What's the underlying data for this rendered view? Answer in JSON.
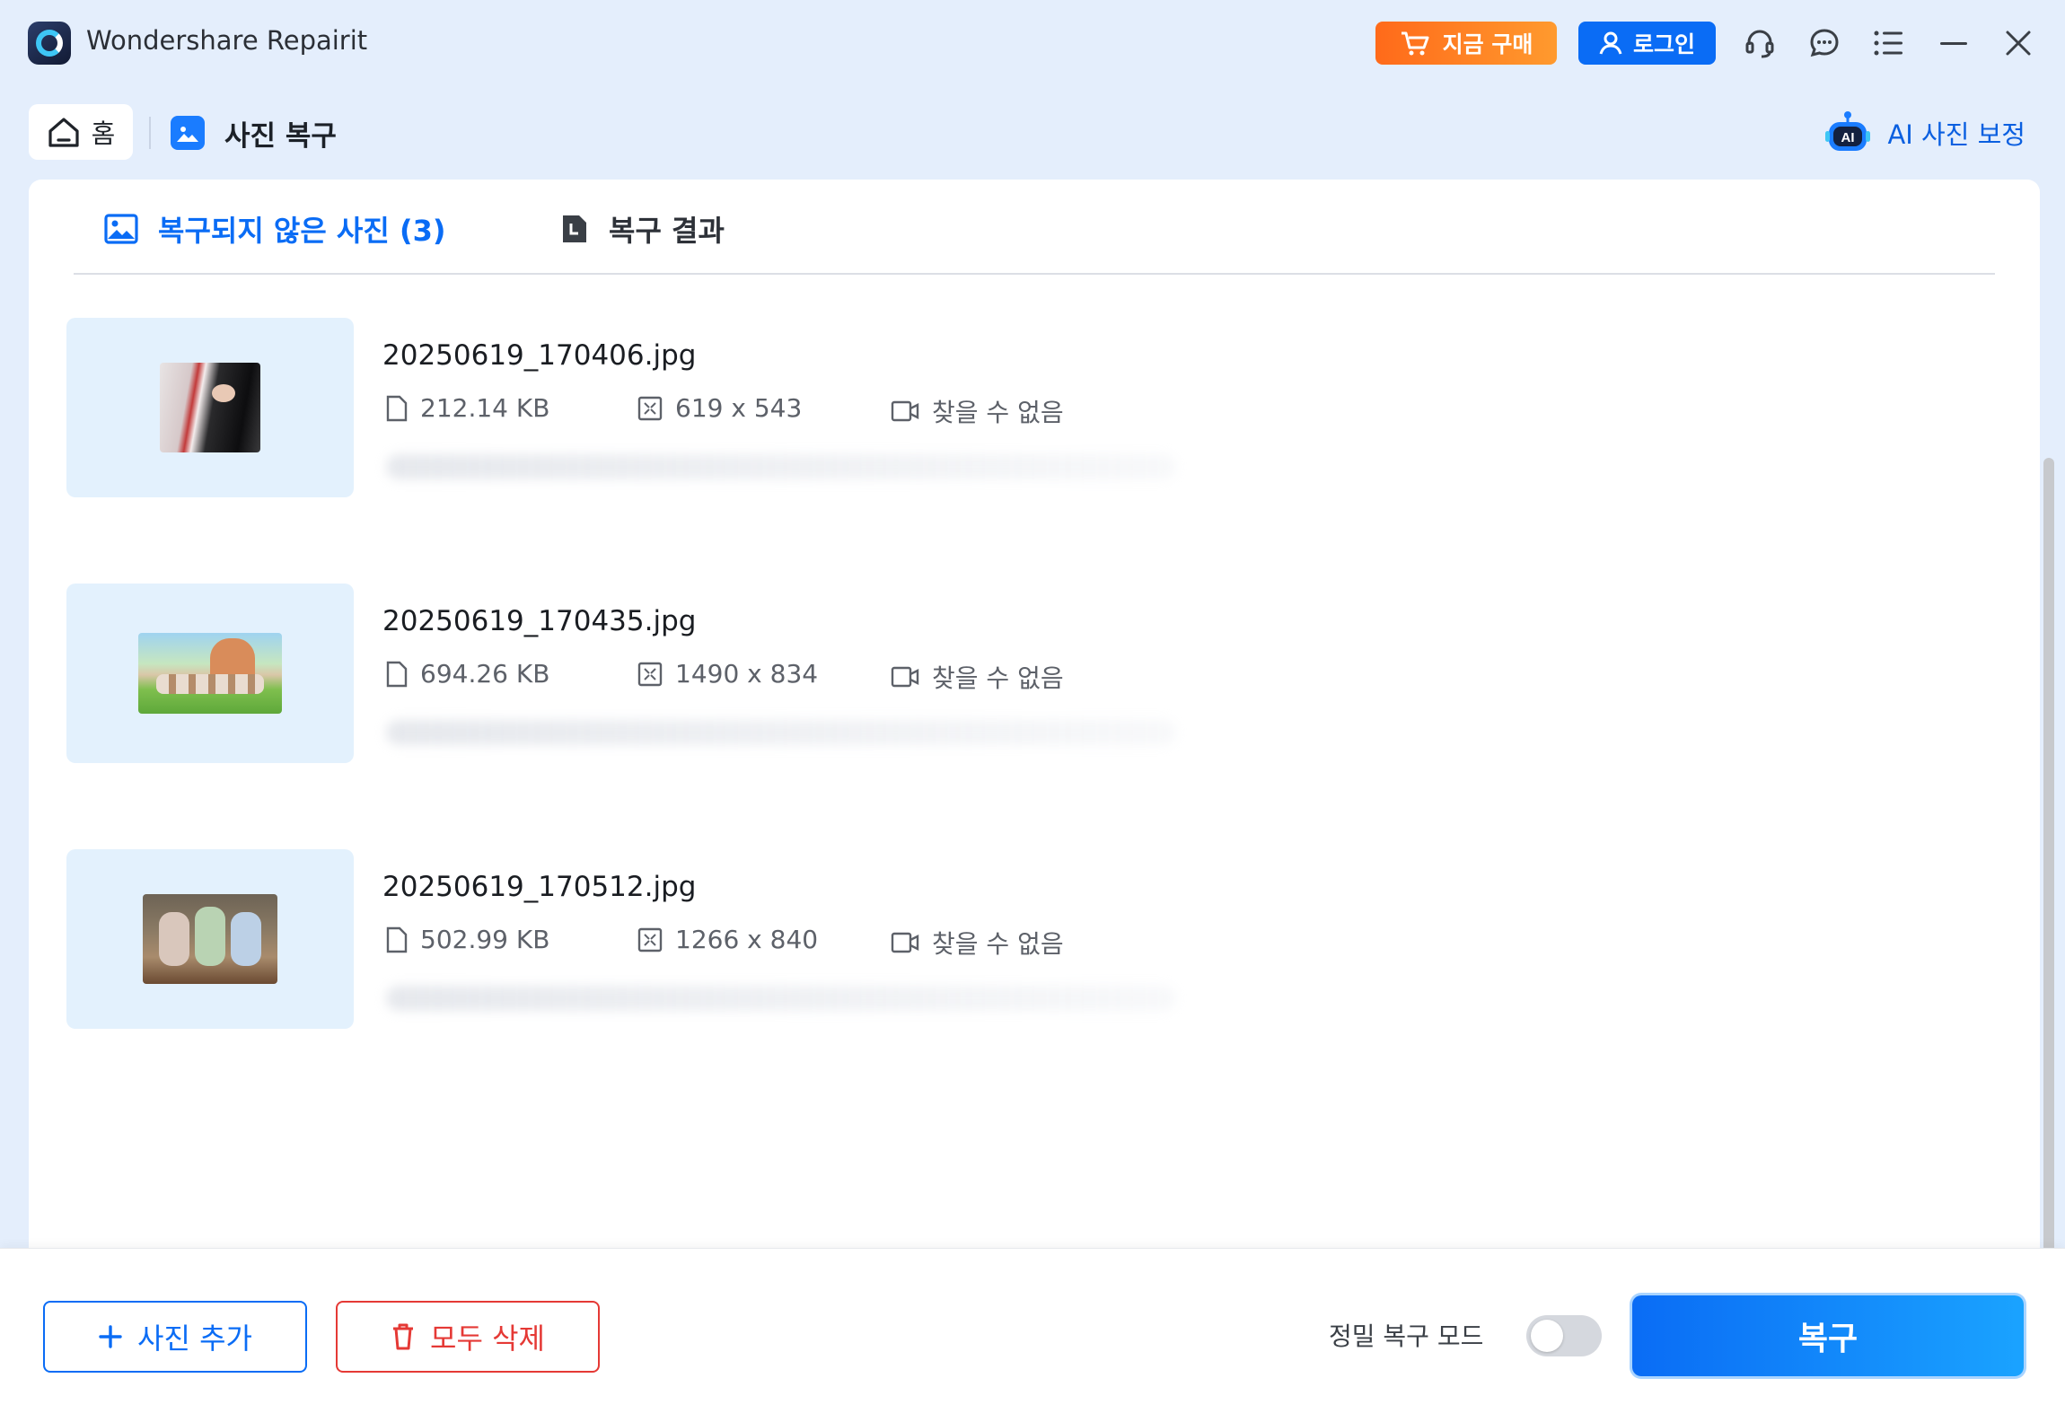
{
  "app": {
    "title": "Wondershare Repairit"
  },
  "titlebar": {
    "buy_label": "지금 구매",
    "login_label": "로그인",
    "icons": [
      "support-icon",
      "feedback-icon",
      "menu-icon",
      "minimize-icon",
      "close-icon"
    ]
  },
  "breadcrumb": {
    "home_label": "홈",
    "current_label": "사진 복구"
  },
  "ai_enhance_label": "AI 사진 보정",
  "tabs": [
    {
      "label": "복구되지 않은 사진 (3)",
      "active": true
    },
    {
      "label": "복구 결과",
      "active": false
    }
  ],
  "files": [
    {
      "name": "20250619_170406.jpg",
      "size": "212.14 KB",
      "dimensions": "619 x 543",
      "device": "찾을 수 없음"
    },
    {
      "name": "20250619_170435.jpg",
      "size": "694.26 KB",
      "dimensions": "1490 x 834",
      "device": "찾을 수 없음"
    },
    {
      "name": "20250619_170512.jpg",
      "size": "502.99 KB",
      "dimensions": "1266 x 840",
      "device": "찾을 수 없음"
    }
  ],
  "footer": {
    "add_label": "사진 추가",
    "delete_all_label": "모두 삭제",
    "precise_mode_label": "정밀 복구 모드",
    "precise_mode_on": false,
    "repair_label": "복구"
  },
  "colors": {
    "accent": "#0a6cf5",
    "buy": "#ff7a1f",
    "danger": "#e53935",
    "thumb_bg": "#e3f1fd"
  }
}
